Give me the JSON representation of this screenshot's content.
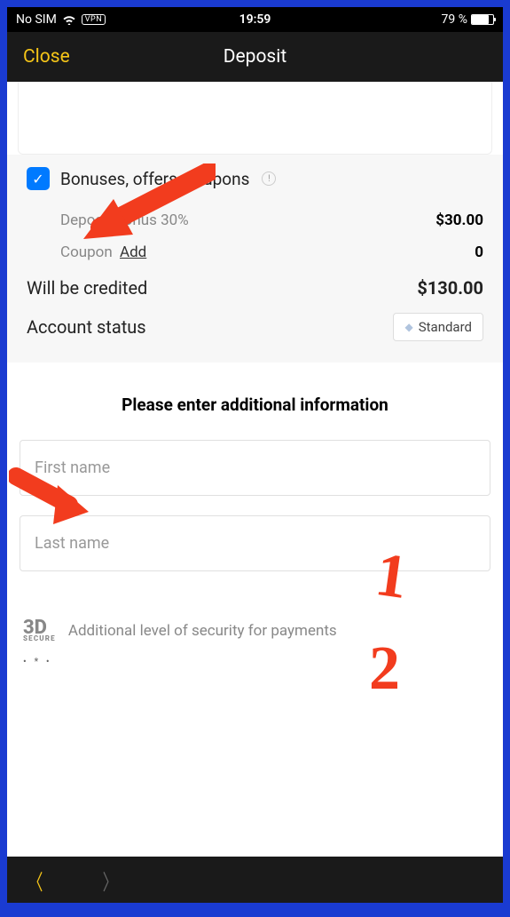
{
  "status": {
    "carrier": "No SIM",
    "vpn": "VPN",
    "time": "19:59",
    "battery_pct": "79 %"
  },
  "nav": {
    "close": "Close",
    "title": "Deposit"
  },
  "bonuses": {
    "label": "Bonuses, offers, coupons",
    "deposit_bonus_label": "Deposit bonus 30%",
    "deposit_bonus_value": "$30.00",
    "coupon_label": "Coupon",
    "coupon_add": "Add",
    "coupon_value": "0"
  },
  "credited": {
    "label": "Will be credited",
    "value": "$130.00"
  },
  "account_status": {
    "label": "Account status",
    "badge": "Standard"
  },
  "form": {
    "heading": "Please enter additional information",
    "first_name_placeholder": "First name",
    "last_name_placeholder": "Last name"
  },
  "secure": {
    "badge_top": "3D",
    "badge_bottom": "SECURE",
    "text": "Additional level of security for payments"
  },
  "annotations": {
    "num1": "1",
    "num2": "2"
  }
}
